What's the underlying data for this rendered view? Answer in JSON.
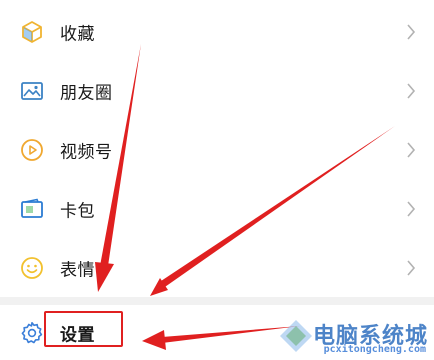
{
  "menu": {
    "items": [
      {
        "label": "收藏",
        "icon": "favorites-cube-icon"
      },
      {
        "label": "朋友圈",
        "icon": "moments-picture-icon"
      },
      {
        "label": "视频号",
        "icon": "channels-play-icon"
      },
      {
        "label": "卡包",
        "icon": "card-wallet-icon"
      },
      {
        "label": "表情",
        "icon": "sticker-smile-icon"
      }
    ],
    "settings": {
      "label": "设置",
      "icon": "gear-icon"
    }
  },
  "watermark": {
    "title": "电脑系统城",
    "url": "pcxitongcheng.com"
  },
  "colors": {
    "annotation_red": "#e02020",
    "favorites_icon": "#f0b431",
    "moments_icon": "#3b82c4",
    "channels_icon": "#f0a830",
    "card_icon": "#2b7cd3",
    "sticker_icon": "#f2c12e",
    "settings_icon": "#3b7fd9"
  }
}
